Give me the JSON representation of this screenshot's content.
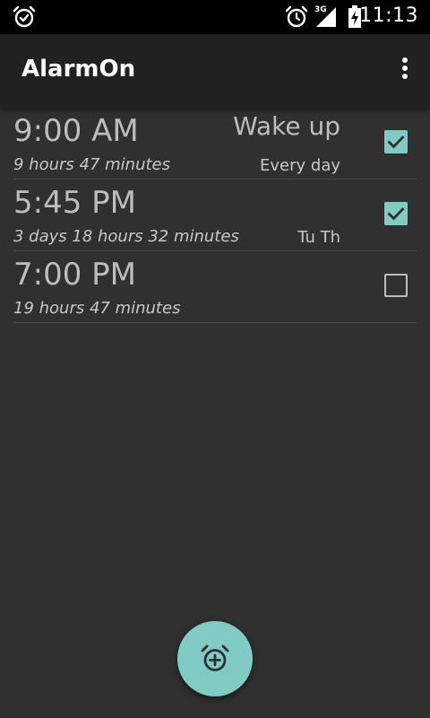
{
  "status_bar": {
    "time": "11:13",
    "network_label": "3G",
    "icons": [
      "alarm-icon",
      "alarm-clock-icon",
      "cell-signal-icon",
      "battery-charging-icon"
    ]
  },
  "toolbar": {
    "title": "AlarmOn",
    "menu_icon": "more-vert-icon"
  },
  "alarms": [
    {
      "time": "9:00 AM",
      "remaining": "9 hours 47 minutes",
      "name": "Wake up",
      "days": "Every day",
      "enabled": true
    },
    {
      "time": "5:45 PM",
      "remaining": "3 days 18 hours 32 minutes",
      "name": "",
      "days": "Tu Th",
      "enabled": true
    },
    {
      "time": "7:00 PM",
      "remaining": "19 hours 47 minutes",
      "name": "",
      "days": "",
      "enabled": false
    }
  ],
  "fab": {
    "icon": "add-alarm-icon"
  },
  "colors": {
    "background": "#303030",
    "toolbar": "#212121",
    "status_bar": "#000000",
    "accent": "#80cbc4",
    "divider": "#4a4a4a",
    "text_primary": "#bdbdbd"
  }
}
